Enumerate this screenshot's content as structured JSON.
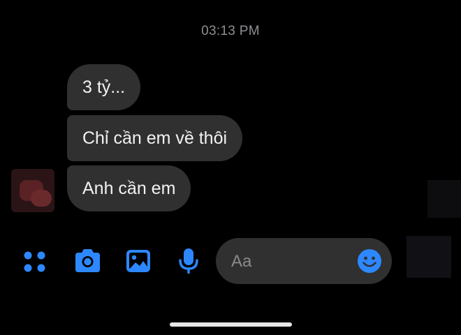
{
  "conversation": {
    "timestamp": "03:13 PM",
    "messages": [
      {
        "text": "3 tỷ..."
      },
      {
        "text": "Chỉ cần em về thôi"
      },
      {
        "text": "Anh cần em"
      }
    ]
  },
  "composer": {
    "placeholder": "Aa"
  },
  "toolbar": {
    "icons": [
      "apps-grid-icon",
      "camera-icon",
      "image-icon",
      "microphone-icon",
      "emoji-icon"
    ]
  },
  "colors": {
    "background": "#000000",
    "bubble": "#303030",
    "accent": "#2d88ff",
    "timestamp": "#8e8e93"
  }
}
